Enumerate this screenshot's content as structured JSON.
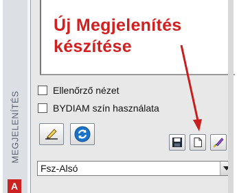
{
  "sidebar": {
    "title": "MEGJELENÍTÉS"
  },
  "annotation": {
    "line1": "Új Megjelenítés",
    "line2": "készítése"
  },
  "options": [
    {
      "label": "Ellenőrző nézet",
      "checked": false
    },
    {
      "label": "BYDIAM szín használata",
      "checked": false
    }
  ],
  "toolbar": {
    "left": [
      {
        "icon": "pencil-icon"
      },
      {
        "icon": "refresh-icon"
      }
    ],
    "right": [
      {
        "icon": "save-icon"
      },
      {
        "icon": "new-document-icon"
      },
      {
        "icon": "edit-brush-icon"
      }
    ]
  },
  "view_select": {
    "value": "Fsz-Alsó"
  },
  "colors": {
    "annotation": "#d0201f",
    "accent_blue": "#1a72c9"
  }
}
